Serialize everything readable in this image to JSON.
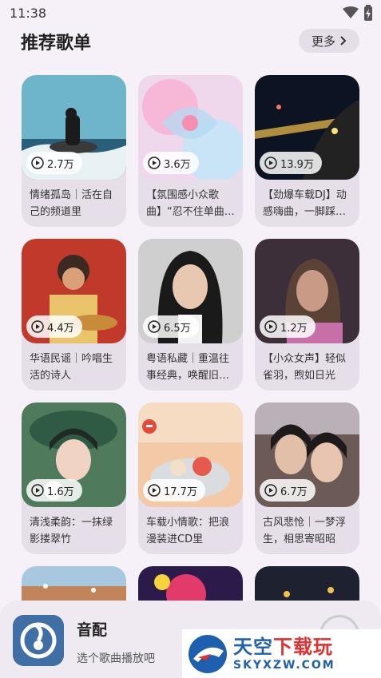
{
  "status": {
    "time": "11:38"
  },
  "section": {
    "title": "推荐歌单",
    "more_label": "更多"
  },
  "playlists": [
    {
      "plays": "2.7万",
      "title": "情绪孤岛｜活在自己的频道里"
    },
    {
      "plays": "3.6万",
      "title": "【氛围感小众歌曲】“忍不住单曲…"
    },
    {
      "plays": "13.9万",
      "title": "【劲爆车载DJ】动感嗨曲，一脚踩…"
    },
    {
      "plays": "4.4万",
      "title": "华语民谣｜吟唱生活的诗人"
    },
    {
      "plays": "6.5万",
      "title": "粤语私藏｜重温往事经典，唤醒旧…"
    },
    {
      "plays": "1.2万",
      "title": "【小众女声】轻似雀羽，煦如日光"
    },
    {
      "plays": "1.6万",
      "title": "清浅柔韵：一抹绿影搂翠竹"
    },
    {
      "plays": "17.7万",
      "title": "车载小情歌：把浪漫装进CD里"
    },
    {
      "plays": "6.7万",
      "title": "古风悲怆｜一梦浮生，相思寄昭昭"
    }
  ],
  "player": {
    "title": "音配",
    "subtitle": "选个歌曲播放吧"
  },
  "watermark": {
    "line1_a": "天空",
    "line1_b": "下载玩",
    "line2": "SKYXZW.COM"
  },
  "colors": {
    "background": "#f6f1f8",
    "card": "#e6dfe9",
    "more_button": "#e4dee8",
    "player_bar": "#efeaf2",
    "watermark_blue": "#1f5fb0",
    "watermark_red": "#e03030"
  },
  "icons": {
    "wifi": "wifi-icon",
    "battery": "battery-icon",
    "more_chevron": "chevron-right-icon",
    "play": "play-circle-icon",
    "app_logo": "music-note-logo"
  }
}
